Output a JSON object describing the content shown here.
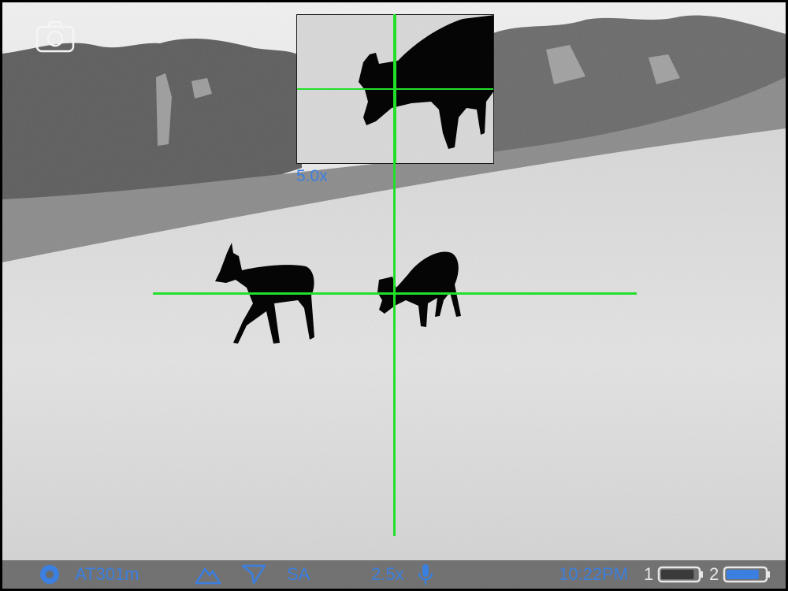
{
  "device": {
    "screen_title": "",
    "colors": {
      "reticle": "#22e02a",
      "accent": "#3b7fe0",
      "status_bar_bg": "#696969",
      "battery_outline": "#e8e8e8"
    }
  },
  "top_controls": {
    "camera_icon": "camera-icon"
  },
  "pip": {
    "zoom_label": "5.0x"
  },
  "status_bar": {
    "mode_icon": "record-circle-icon",
    "range_text": "AT301m",
    "terrain_icon": "mountain-icon",
    "gps_icon": "navigation-arrow-icon",
    "mode_text": "SA",
    "zoom_text": "2.5x",
    "mic_icon": "microphone-icon",
    "time_text": "10:22PM",
    "battery1_label": "1",
    "battery1_level": 0.9,
    "battery2_label": "2",
    "battery2_level": 0.85
  }
}
